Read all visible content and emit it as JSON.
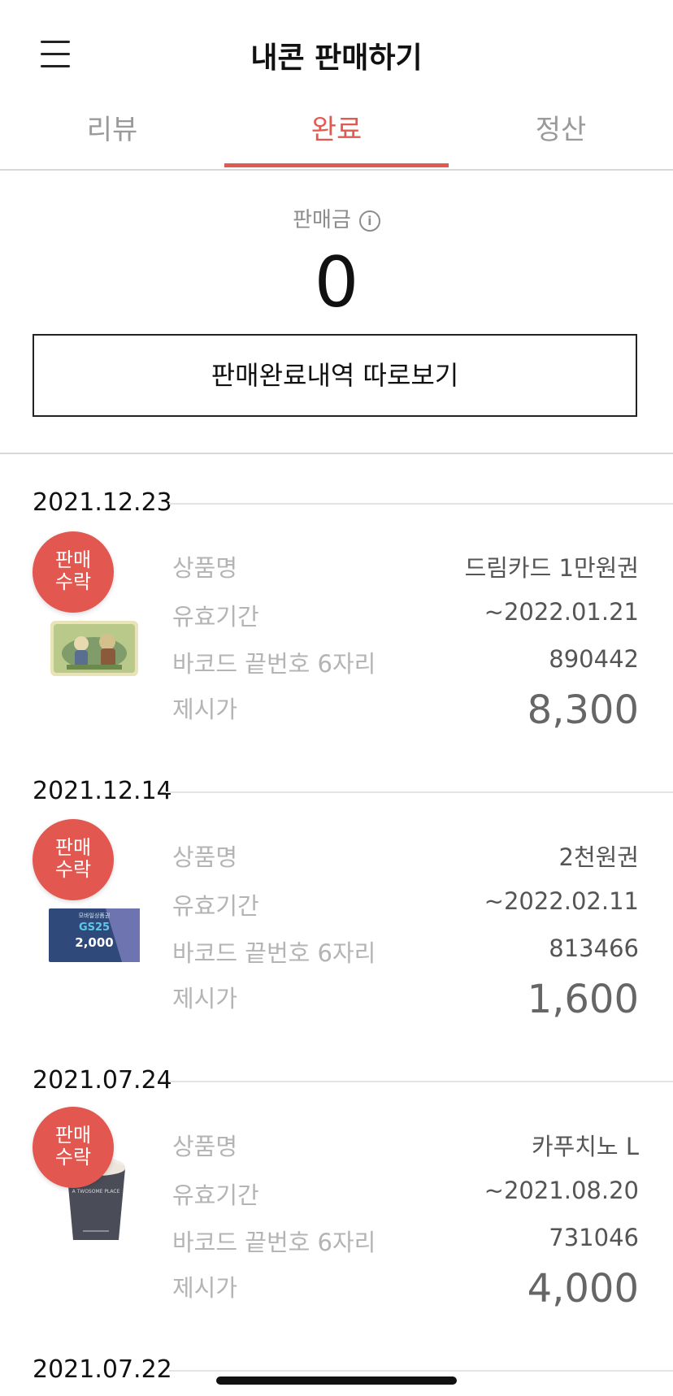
{
  "header": {
    "title": "내콘 판매하기",
    "menu_icon": "hamburger-icon"
  },
  "tabs": [
    {
      "label": "리뷰"
    },
    {
      "label": "완료"
    },
    {
      "label": "정산"
    }
  ],
  "summary": {
    "label": "판매금",
    "info_icon_glyph": "i",
    "amount": "0",
    "button_label": "판매완료내역 따로보기"
  },
  "colors": {
    "accent": "#e15a50",
    "badge": "#e2574f"
  },
  "items": [
    {
      "date": "2021.12.23",
      "badge_line1": "판매",
      "badge_line2": "수락",
      "thumb": "dream-card-image",
      "rows": [
        {
          "label": "상품명",
          "value": "드림카드 1만원권"
        },
        {
          "label": "유효기간",
          "value": "~2022.01.21"
        },
        {
          "label": "바코드 끝번호 6자리",
          "value": "890442"
        },
        {
          "label": "제시가",
          "value": "8,300"
        }
      ]
    },
    {
      "date": "2021.12.14",
      "badge_line1": "판매",
      "badge_line2": "수락",
      "thumb": "gs25-voucher-image",
      "thumb_text_top": "모바일상품권",
      "thumb_text_brand": "GS25",
      "thumb_text_amount": "2,000",
      "rows": [
        {
          "label": "상품명",
          "value": "2천원권"
        },
        {
          "label": "유효기간",
          "value": "~2022.02.11"
        },
        {
          "label": "바코드 끝번호 6자리",
          "value": "813466"
        },
        {
          "label": "제시가",
          "value": "1,600"
        }
      ]
    },
    {
      "date": "2021.07.24",
      "badge_line1": "판매",
      "badge_line2": "수락",
      "thumb": "coffee-cup-image",
      "thumb_text_brand": "A TWOSOME PLACE",
      "rows": [
        {
          "label": "상품명",
          "value": "카푸치노 L"
        },
        {
          "label": "유효기간",
          "value": "~2021.08.20"
        },
        {
          "label": "바코드 끝번호 6자리",
          "value": "731046"
        },
        {
          "label": "제시가",
          "value": "4,000"
        }
      ]
    },
    {
      "date": "2021.07.22"
    }
  ]
}
